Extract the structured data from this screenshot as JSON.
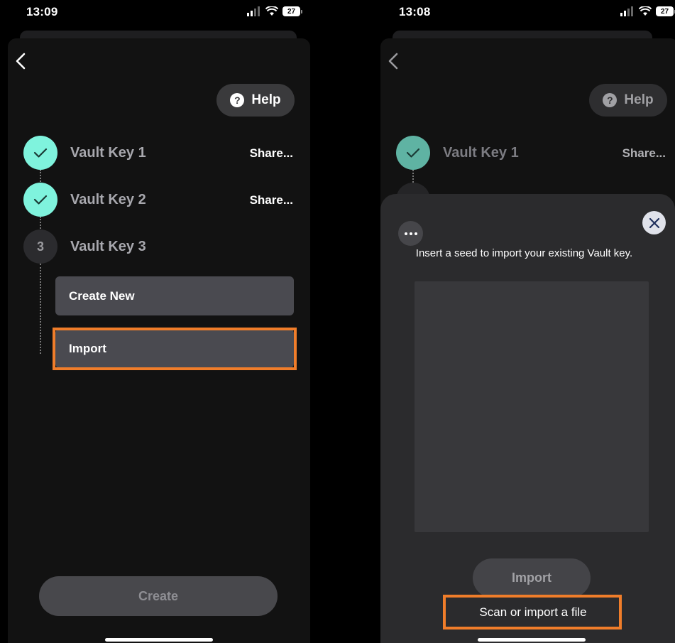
{
  "left": {
    "status": {
      "time": "13:09",
      "battery": "27"
    },
    "help_label": "Help",
    "help_glyph": "?",
    "steps": [
      {
        "name": "Vault Key 1",
        "action": "Share..."
      },
      {
        "name": "Vault Key 2",
        "action": "Share..."
      },
      {
        "name": "Vault Key 3",
        "number": "3"
      }
    ],
    "options": {
      "create_new": "Create New",
      "import": "Import"
    },
    "create_label": "Create"
  },
  "right": {
    "status": {
      "time": "13:08",
      "battery": "27"
    },
    "help_label": "Help",
    "help_glyph": "?",
    "steps": [
      {
        "name": "Vault Key 1",
        "action": "Share..."
      }
    ],
    "modal": {
      "description": "Insert a seed to import your existing Vault key.",
      "import_label": "Import",
      "scan_label": "Scan or import a file"
    }
  },
  "colors": {
    "accent_teal": "#7ff3dd",
    "highlight_orange": "#f07d2a",
    "sheet_bg": "#121212",
    "modal_bg": "#2b2b2d"
  },
  "icons": [
    "signal-icon",
    "wifi-icon",
    "battery-icon",
    "back-chevron-icon",
    "help-icon",
    "checkmark-icon",
    "more-icon",
    "close-icon"
  ]
}
